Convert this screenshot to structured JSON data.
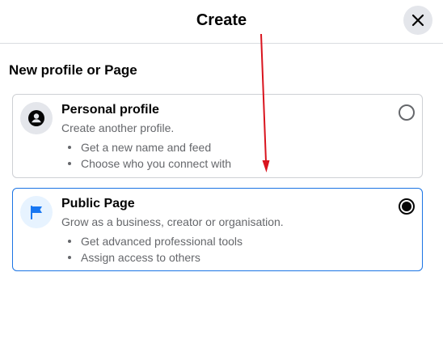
{
  "dialog": {
    "title": "Create",
    "close_icon": "close-icon"
  },
  "section": {
    "title": "New profile or Page"
  },
  "options": [
    {
      "title": "Personal profile",
      "subtitle": "Create another profile.",
      "bullets": [
        "Get a new name and feed",
        "Choose who you connect with"
      ],
      "icon": "profile-icon",
      "selected": false
    },
    {
      "title": "Public Page",
      "subtitle": "Grow as a business, creator or organisation.",
      "bullets": [
        "Get advanced professional tools",
        "Assign access to others"
      ],
      "icon": "flag-icon",
      "selected": true
    }
  ],
  "colors": {
    "accent": "#1b74e4",
    "annotation_arrow": "#d9141e",
    "flag": "#1877f2"
  }
}
